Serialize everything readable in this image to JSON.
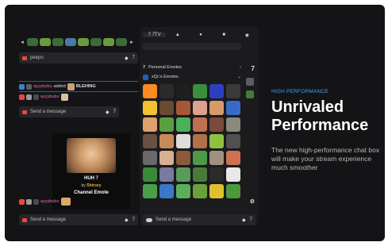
{
  "left": {
    "strip_arrows": {
      "left": "◂",
      "right": "▸"
    },
    "top_input": {
      "text": "peepo"
    },
    "chat": [
      {
        "user": "ayyybubu",
        "action": "added",
        "emote": "BLEHING"
      },
      {
        "user": "ayyybubu"
      }
    ],
    "message_placeholder": "Send a message",
    "emote_card": {
      "name": "HUH",
      "by_label": "by",
      "author": "Shiroxy",
      "kind": "Channel Emote"
    },
    "bottom_chat_user": "ayyybubu",
    "bottom_placeholder": "Send a message"
  },
  "picker": {
    "tabs": [
      {
        "label": "7TV",
        "icon": "7tv-icon"
      },
      {
        "label": "",
        "icon": "twitch-icon"
      },
      {
        "label": "",
        "icon": "bttv-icon"
      },
      {
        "label": "",
        "icon": "ffz-icon"
      },
      {
        "label": "",
        "icon": "emoji-icon"
      }
    ],
    "sets": [
      {
        "label": "Personal Emotes",
        "chevron": "›"
      },
      {
        "label": "xQc's Emotes",
        "chevron": "⌄"
      }
    ],
    "input_placeholder": "Send a message"
  },
  "hero": {
    "kicker": "HIGH PERFORMANCE",
    "headline": "Unrivaled Performance",
    "description": "The new high-performance chat box will make your stream experience much smoother"
  },
  "colors": {
    "accent_blue": "#3aa6ff",
    "background": "#141416",
    "panel": "#1b1b1e",
    "red_icon": "#e8483b",
    "gold": "#e7b02b"
  }
}
